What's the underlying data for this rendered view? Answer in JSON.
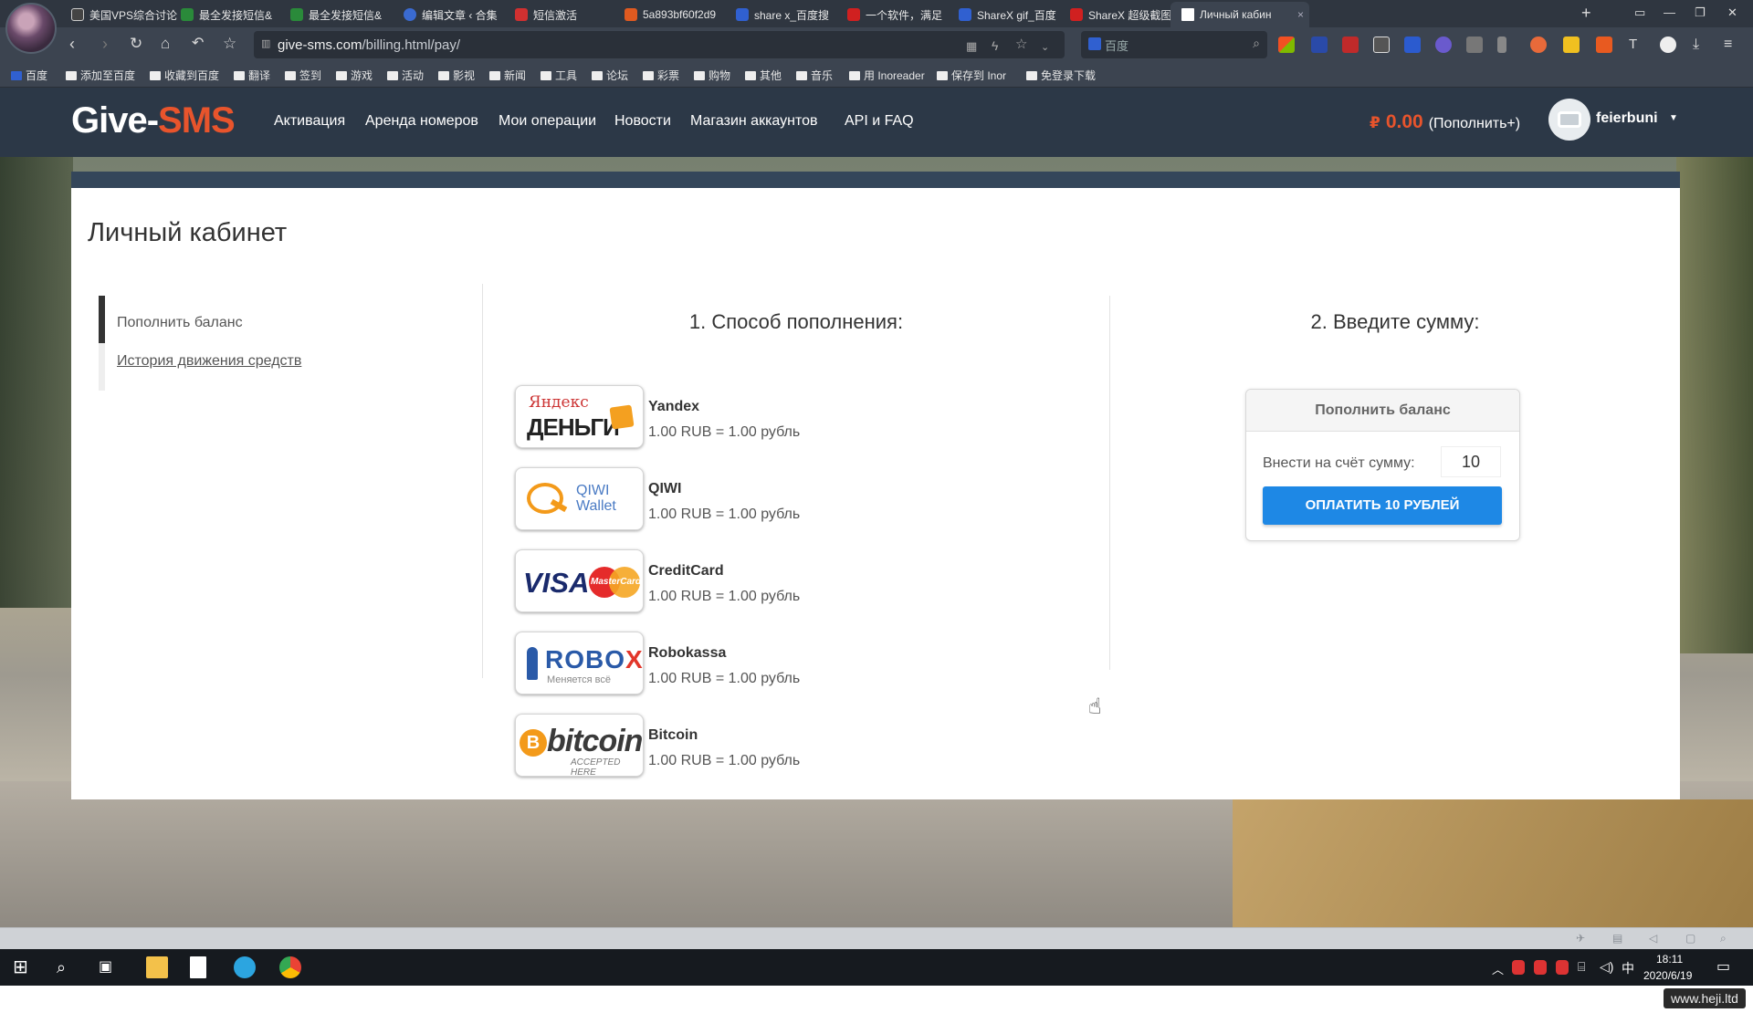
{
  "browser": {
    "tabs": [
      {
        "title": "美国VPS综合讨论",
        "color": "#4a4a4a"
      },
      {
        "title": "最全发接短信&",
        "color": "#2a8a3a"
      },
      {
        "title": "最全发接短信&",
        "color": "#2a8a3a"
      },
      {
        "title": "编辑文章 ‹ 合集",
        "color": "#3a6ad0"
      },
      {
        "title": "短信激活",
        "color": "#d03030"
      },
      {
        "title": "5a893bf60f2d9",
        "color": "#e05a20"
      },
      {
        "title": "share x_百度搜",
        "color": "#3060d0"
      },
      {
        "title": "一个软件，满足",
        "color": "#d02020"
      },
      {
        "title": "ShareX gif_百度",
        "color": "#3060d0"
      },
      {
        "title": "ShareX 超级截图",
        "color": "#d02020"
      },
      {
        "title": "Личный кабин",
        "color": "#ffffff"
      }
    ],
    "close_glyph": "×",
    "new_tab_glyph": "+",
    "url_host": "give-sms.com",
    "url_path": "/billing.html/pay/",
    "search_placeholder": "百度",
    "bookmarks": [
      "百度",
      "添加至百度",
      "收藏到百度",
      "翻译",
      "签到",
      "游戏",
      "活动",
      "影视",
      "新闻",
      "工具",
      "论坛",
      "彩票",
      "购物",
      "其他",
      "音乐",
      "用 Inoreader",
      "保存到 Inor",
      "免登录下载"
    ]
  },
  "site": {
    "logo_part1": "Give-",
    "logo_part2": "SMS",
    "menu": [
      "Активация",
      "Аренда номеров",
      "Мои операции",
      "Новости",
      "Магазин аккаунтов",
      "API и FAQ"
    ],
    "balance_currency": "₽",
    "balance_amount": "0.00",
    "balance_action": "(Пополнить+)",
    "username": "feierbuni",
    "caret": "▼"
  },
  "cabinet": {
    "title": "Личный кабинет",
    "side_nav": [
      "Пополнить баланс",
      "История движения средств"
    ],
    "method_title": "1. Способ пополнения:",
    "amount_title": "2. Введите сумму:",
    "methods": [
      {
        "name": "Yandex",
        "rate": "1.00 RUB = 1.00 рубль",
        "logo_text1": "Яндекс",
        "logo_text2": "ДЕНЬГИ"
      },
      {
        "name": "QIWI",
        "rate": "1.00 RUB = 1.00 рубль",
        "logo_text1": "QIWI",
        "logo_text2": "Wallet"
      },
      {
        "name": "CreditCard",
        "rate": "1.00 RUB = 1.00 рубль",
        "logo_text1": "VISA",
        "logo_text2": "MasterCard"
      },
      {
        "name": "Robokassa",
        "rate": "1.00 RUB = 1.00 рубль",
        "logo_text1": "ROBO",
        "logo_text2": "X",
        "logo_text3": "Меняется всё"
      },
      {
        "name": "Bitcoin",
        "rate": "1.00 RUB = 1.00 рубль",
        "logo_text1": "bitcoin",
        "logo_text2": "ACCEPTED HERE",
        "logo_text3": "B"
      }
    ],
    "pay_form": {
      "header": "Пополнить баланс",
      "amount_label": "Внести на счёт сумму:",
      "amount_value": "10",
      "pay_button": "ОПЛАТИТЬ 10 РУБЛЕЙ"
    }
  },
  "taskbar": {
    "time": "18:11",
    "date": "2020/6/19",
    "ime": "中",
    "watermark": "www.heji.ltd"
  },
  "colors": {
    "brand_accent": "#e8542c",
    "site_header": "#2c3847",
    "pay_button": "#1e88e5"
  },
  "icons": [
    "back-icon",
    "forward-icon",
    "reload-icon",
    "home-icon",
    "undo-icon",
    "star-icon",
    "search-icon",
    "windows-start-icon",
    "folder-icon",
    "telegram-icon",
    "chrome-icon",
    "notification-icon"
  ]
}
